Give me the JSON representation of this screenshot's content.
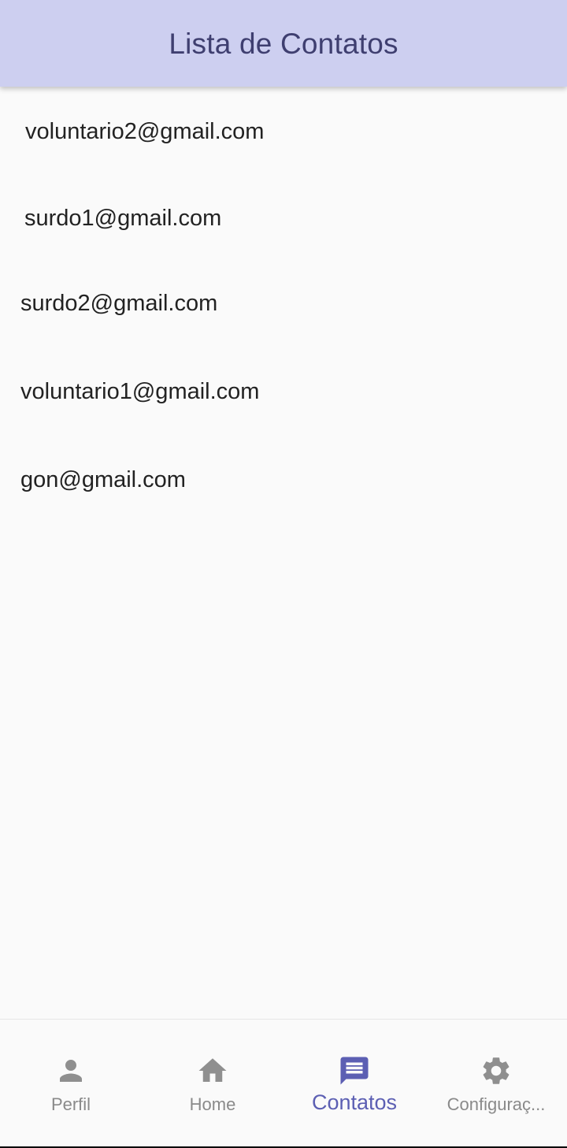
{
  "app_bar": {
    "title": "Lista de Contatos"
  },
  "contacts": [
    "voluntario2@gmail.com",
    "surdo1@gmail.com",
    "surdo2@gmail.com",
    "voluntario1@gmail.com",
    "gon@gmail.com"
  ],
  "bottom_nav": {
    "items": [
      {
        "label": "Perfil",
        "icon": "person-icon",
        "active": false
      },
      {
        "label": "Home",
        "icon": "home-icon",
        "active": false
      },
      {
        "label": "Contatos",
        "icon": "chat-icon",
        "active": true
      },
      {
        "label": "Configuraç...",
        "icon": "gear-icon",
        "active": false
      }
    ]
  },
  "colors": {
    "app_bar_bg": "#cdcff0",
    "title": "#3f3f70",
    "active": "#5c5fb3",
    "inactive": "#8a8a8a",
    "background": "#fafafa"
  }
}
